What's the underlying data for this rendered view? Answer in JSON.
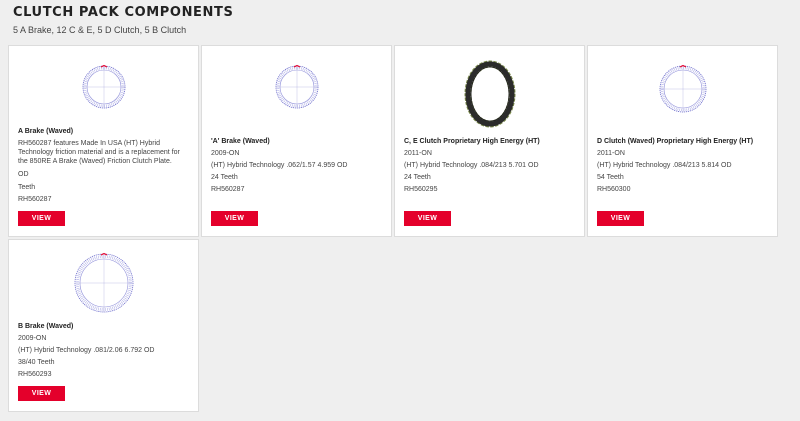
{
  "section": {
    "title": "CLUTCH PACK COMPONENTS",
    "subtitle": "5 A Brake, 12 C & E, 5 D Clutch, 5 B Clutch"
  },
  "colors": {
    "accent": "#e4002b",
    "ring_outline": "#5b5bc0",
    "ring_dark": "#2b2b2b",
    "ring_dark_edge": "#7a8a4a"
  },
  "cards": [
    {
      "image_icon": "waved-friction-plate-icon",
      "name": "A Brake (Waved)",
      "lines": [
        "RH560287 features Made In USA (HT) Hybrid",
        "Technology friction material and is a replacement for",
        "the 850RE A Brake (Waved) Friction Clutch Plate.",
        "OD",
        "Teeth",
        "RH560287"
      ],
      "button": "VIEW"
    },
    {
      "image_icon": "waved-friction-plate-icon",
      "name": "'A' Brake (Waved)",
      "lines": [
        "2009-ON",
        "(HT) Hybrid Technology .062/1.57 4.959 OD",
        "24 Teeth",
        "RH560287"
      ],
      "button": "VIEW"
    },
    {
      "image_icon": "high-energy-friction-plate-icon",
      "name": "C, E Clutch Proprietary High Energy (HT)",
      "lines": [
        "2011-ON",
        "(HT) Hybrid Technology .084/213 5.701 OD",
        "24 Teeth",
        "RH560295"
      ],
      "button": "VIEW"
    },
    {
      "image_icon": "waved-friction-plate-icon",
      "name": "D Clutch (Waved) Proprietary High Energy (HT)",
      "lines": [
        "2011-ON",
        "(HT) Hybrid Technology .084/213 5.814 OD",
        "54 Teeth",
        "RH560300"
      ],
      "button": "VIEW"
    },
    {
      "image_icon": "waved-friction-plate-icon",
      "name": "B Brake (Waved)",
      "lines": [
        "2009-ON",
        "(HT) Hybrid Technology .081/2.06 6.792 OD",
        "38/40 Teeth",
        "RH560293"
      ],
      "button": "VIEW"
    }
  ]
}
